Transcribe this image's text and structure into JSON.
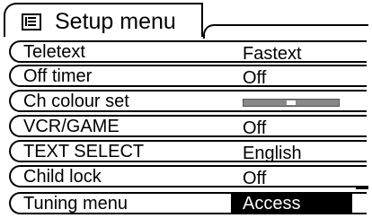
{
  "header": {
    "title": "Setup menu",
    "icon": "menu-list-icon"
  },
  "menu": {
    "items": [
      {
        "label": "Teletext",
        "value": "Fastext",
        "type": "value"
      },
      {
        "label": "Off timer",
        "value": "Off",
        "type": "value"
      },
      {
        "label": "Ch colour set",
        "value": "",
        "type": "slider",
        "level": 0.5
      },
      {
        "label": "VCR/GAME",
        "value": "Off",
        "type": "value"
      },
      {
        "label": "TEXT SELECT",
        "value": "English",
        "type": "value"
      },
      {
        "label": "Child lock",
        "value": "Off",
        "type": "value"
      },
      {
        "label": "Tuning menu",
        "value": "Access",
        "type": "value",
        "selected": true
      }
    ]
  },
  "colors": {
    "background": "#ffffff",
    "text": "#000000",
    "selected_value_bg": "#000000",
    "selected_value_text": "#ffffff",
    "slider_track": "#888888",
    "slider_knob": "#ffffff"
  }
}
